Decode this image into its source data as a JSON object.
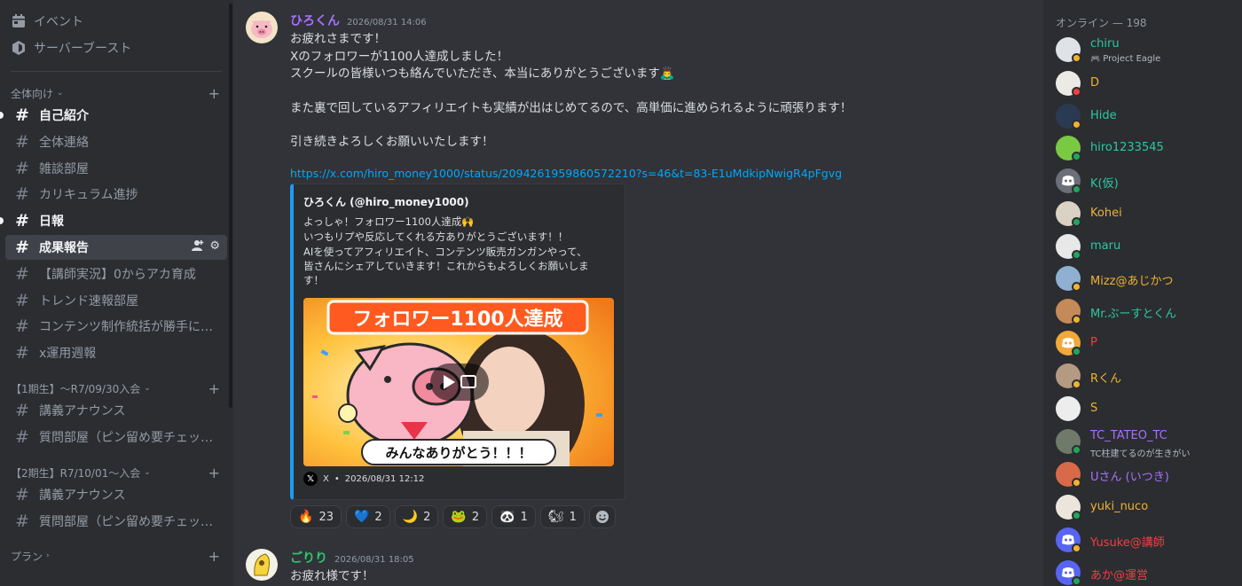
{
  "sidebar": {
    "top": [
      {
        "label": "イベント",
        "icon": "calendar-icon"
      },
      {
        "label": "サーバーブースト",
        "icon": "boost-icon"
      }
    ],
    "categories": {
      "general": "全体向け",
      "gen1": "【1期生】〜R7/09/30入会",
      "gen2": "【2期生】R7/10/01〜入会",
      "plan": "プラン"
    },
    "channels_general": [
      {
        "label": "自己紹介",
        "state": "unread"
      },
      {
        "label": "全体連絡",
        "state": "normal"
      },
      {
        "label": "雑談部屋",
        "state": "normal"
      },
      {
        "label": "カリキュラム進捗",
        "state": "normal"
      },
      {
        "label": "日報",
        "state": "unread"
      },
      {
        "label": "成果報告",
        "state": "active"
      },
      {
        "label": "【講師実況】0からアカ育成",
        "state": "normal"
      },
      {
        "label": "トレンド速報部屋",
        "state": "normal"
      },
      {
        "label": "コンテンツ制作統括が勝手に…",
        "state": "normal"
      },
      {
        "label": "x運用週報",
        "state": "normal"
      }
    ],
    "channels_gen1": [
      {
        "label": "講義アナウンス"
      },
      {
        "label": "質問部屋（ピン留め要チェッ…"
      }
    ],
    "channels_gen2": [
      {
        "label": "講義アナウンス"
      },
      {
        "label": "質問部屋（ピン留め要チェッ…"
      }
    ]
  },
  "messages": [
    {
      "author": "ひろくん",
      "author_color": "#a970ff",
      "timestamp": "2026/08/31 14:06",
      "lines": [
        "お疲れさまです！",
        "Xのフォロワーが1100人達成しました！",
        "スクールの皆様いつも絡んでいただき、本当にありがとうございます🙇‍♂️",
        "また裏で回しているアフィリエイトも実績が出はじめてるので、高単価に進められるように頑張ります！",
        "引き続きよろしくお願いいたします！"
      ],
      "link": "https://x.com/hiro_money1000/status/2094261959860572210?s=46&t=83-E1uMdkipNwigR4pFgvg",
      "embed": {
        "author": "ひろくん (@hiro_money1000)",
        "lines": [
          "よっしゃ！フォロワー1100人達成🙌",
          "いつもリプや反応してくれる方ありがとうございます！！",
          "AIを使ってアフィリエイト、コンテンツ販売ガンガンやって、",
          "皆さんにシェアしていきます！これからもよろしくお願いしま",
          "す！"
        ],
        "image_title": "フォロワー1100人達成",
        "image_caption": "みんなありがとう！！！",
        "footer_source": "X",
        "footer_time": "2026/08/31 12:12"
      },
      "reactions": [
        {
          "emoji": "🔥",
          "count": "23"
        },
        {
          "emoji": "💙",
          "count": "2"
        },
        {
          "emoji": "🌙",
          "count": "2"
        },
        {
          "emoji": "🐸",
          "count": "2"
        },
        {
          "emoji": "🐼",
          "count": "1"
        },
        {
          "emoji": "🐿",
          "count": "1"
        }
      ]
    },
    {
      "author": "ごりり",
      "author_color": "#2dc770",
      "timestamp": "2026/08/31 18:05",
      "lines": [
        "お疲れ様です！"
      ]
    }
  ],
  "members": {
    "title": "オンライン — 198",
    "list": [
      {
        "name": "chiru",
        "color": "#2dc7a0",
        "sub": "Project Eagle",
        "status": "#f0b232",
        "av": "#dfe3e8"
      },
      {
        "name": "D",
        "color": "#f0b232",
        "sub": "",
        "status": "#f23f43",
        "av": "#eceae4"
      },
      {
        "name": "Hide",
        "color": "#2dc7a0",
        "sub": "",
        "status": "#f0b232",
        "av": "#2a3a52"
      },
      {
        "name": "hiro1233545",
        "color": "#2dc7a0",
        "sub": "",
        "status": "#23a55a",
        "av": "#7ac943"
      },
      {
        "name": "K(仮)",
        "color": "#2dc7a0",
        "sub": "",
        "status": "#23a55a",
        "av": "#6d6f78"
      },
      {
        "name": "Kohei",
        "color": "#f0b232",
        "sub": "",
        "status": "#23a55a",
        "av": "#d9d2c5"
      },
      {
        "name": "maru",
        "color": "#2dc7a0",
        "sub": "",
        "status": "#23a55a",
        "av": "#e8e8e8"
      },
      {
        "name": "Mizz@あじかつ",
        "color": "#f0b232",
        "sub": "",
        "status": "#f0b232",
        "av": "#8fb0d0"
      },
      {
        "name": "Mr.ぶーすとくん",
        "color": "#2dc7a0",
        "sub": "",
        "status": "#f0b232",
        "av": "#c58a5a"
      },
      {
        "name": "P",
        "color": "#f23f43",
        "sub": "",
        "status": "#23a55a",
        "av": "#f0a93a"
      },
      {
        "name": "Rくん",
        "color": "#f0b232",
        "sub": "",
        "status": "#f0b232",
        "av": "#b59a82"
      },
      {
        "name": "S",
        "color": "#f0b232",
        "sub": "",
        "status": "",
        "av": "#ededed"
      },
      {
        "name": "TC_TATEO_TC",
        "color": "#a970ff",
        "sub": "TC柱建てるのが生きがい",
        "status": "#23a55a",
        "av": "#6f7a6a"
      },
      {
        "name": "Uさん (いつき)",
        "color": "#a970ff",
        "sub": "",
        "status": "#f0b232",
        "av": "#d86a4a"
      },
      {
        "name": "yuki_nuco",
        "color": "#f0b232",
        "sub": "",
        "status": "#23a55a",
        "av": "#ebe5dc"
      },
      {
        "name": "Yusuke@講師",
        "color": "#f23f43",
        "sub": "",
        "status": "#f0b232",
        "av": "#5865f2"
      },
      {
        "name": "あか@運営",
        "color": "#f23f43",
        "sub": "",
        "status": "#23a55a",
        "av": "#5865f2"
      }
    ]
  }
}
